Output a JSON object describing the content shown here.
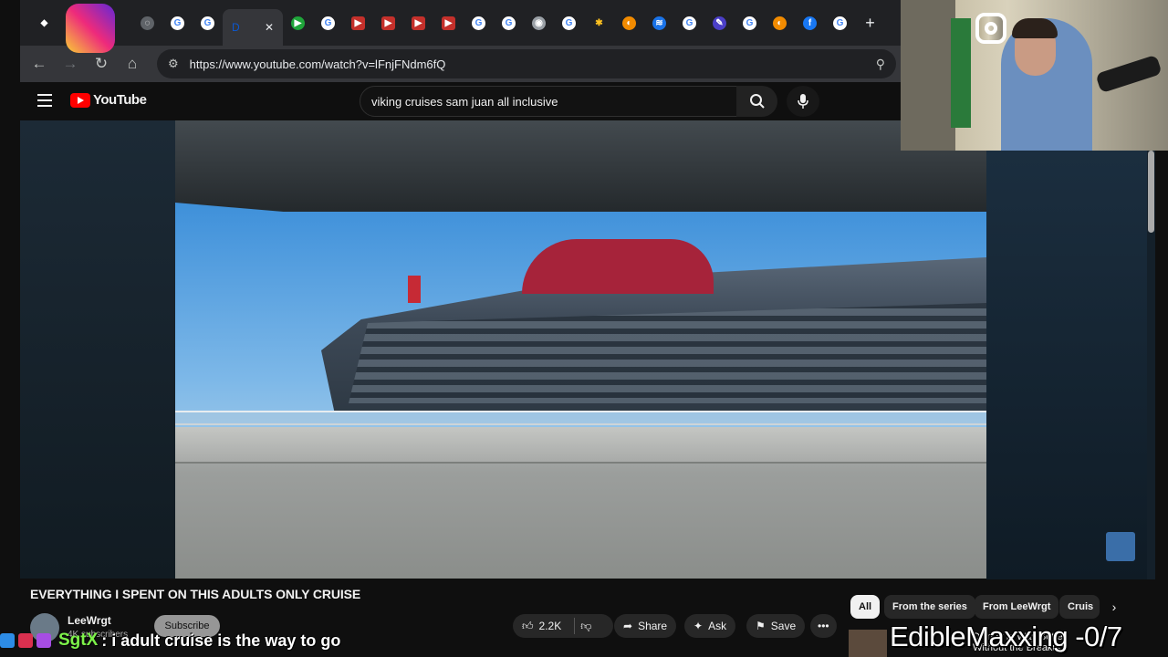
{
  "browser": {
    "address": "https://www.youtube.com/watch?v=lFnjFNdm6fQ",
    "new_tab": "+",
    "close_tab": "✕"
  },
  "youtube": {
    "logo_text": "YouTube",
    "search_query": "viking cruises sam juan all inclusive"
  },
  "video": {
    "title": "EVERYTHING I SPENT ON THIS ADULTS ONLY CRUISE",
    "channel": "LeeWrgt",
    "subscribers": "4K subscribers",
    "subscribe_label": "Subscribe",
    "likes": "2.2K",
    "share_label": "Share",
    "ask_label": "Ask",
    "save_label": "Save",
    "more_label": "•••"
  },
  "chips": [
    "All",
    "From the series",
    "From LeeWrgt",
    "Cruis"
  ],
  "recommended": {
    "title": "Disney Is Way Better Without the Breakup"
  },
  "stream": {
    "chat_user": "SgtX",
    "chat_message": ": i adult cruise is the way to go",
    "ticker": "EdibleMaxxing -0/7"
  },
  "colors": {
    "youtube_red": "#ff0000",
    "chat_user": "#7df24a",
    "background": "#0f0f0f"
  }
}
